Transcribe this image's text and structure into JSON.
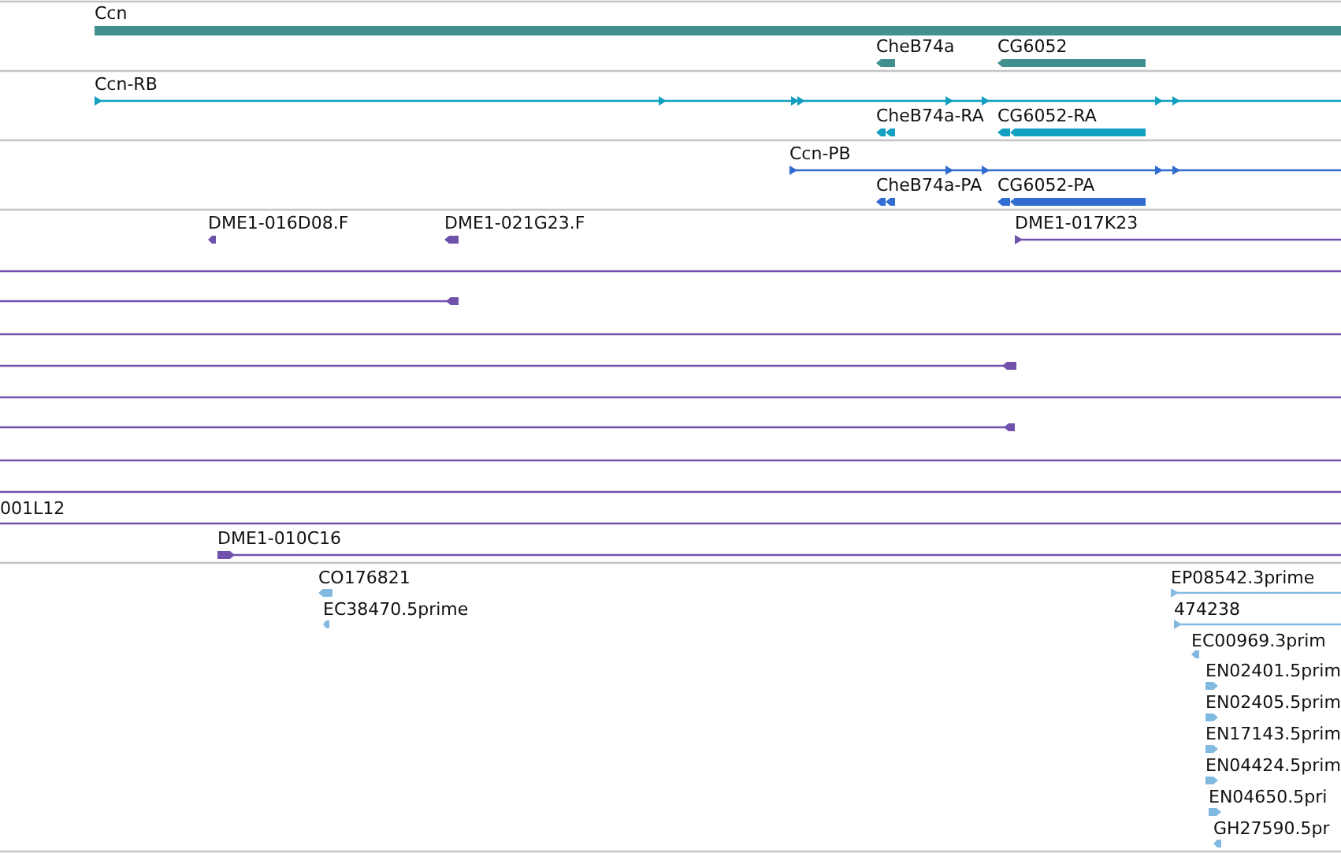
{
  "tracks": [
    {
      "color": "#418f8f",
      "features": [
        {
          "label": "Ccn",
          "kind": "block",
          "forward": true
        },
        {
          "label": "CheB74a",
          "kind": "block",
          "forward": false
        },
        {
          "label": "CG6052",
          "kind": "block",
          "forward": false
        }
      ]
    },
    {
      "color": "#12a0c0",
      "features": [
        {
          "label": "Ccn-RB",
          "kind": "line",
          "forward": true
        },
        {
          "label": "CheB74a-RA",
          "kind": "block",
          "forward": false
        },
        {
          "label": "CG6052-RA",
          "kind": "block",
          "forward": false
        }
      ]
    },
    {
      "color": "#316cd0",
      "features": [
        {
          "label": "Ccn-PB",
          "kind": "line",
          "forward": true
        },
        {
          "label": "CheB74a-PA",
          "kind": "block",
          "forward": false
        },
        {
          "label": "CG6052-PA",
          "kind": "block",
          "forward": false
        }
      ]
    },
    {
      "color": "#7052ad",
      "features": [
        {
          "label": "DME1-016D08.F",
          "kind": "block",
          "forward": false
        },
        {
          "label": "DME1-021G23.F",
          "kind": "block",
          "forward": false
        },
        {
          "label": "DME1-017K23",
          "kind": "line",
          "forward": true
        },
        {
          "kind": "line"
        },
        {
          "kind": "line",
          "forward": false
        },
        {
          "kind": "line"
        },
        {
          "kind": "line",
          "forward": false
        },
        {
          "kind": "line"
        },
        {
          "kind": "line",
          "forward": false
        },
        {
          "kind": "line"
        },
        {
          "kind": "line"
        },
        {
          "label": "001L12",
          "kind": "line"
        },
        {
          "label": "DME1-010C16",
          "kind": "line",
          "forward": true
        }
      ]
    },
    {
      "color": "#82b9e0",
      "features": [
        {
          "label": "CO176821",
          "kind": "block",
          "forward": false
        },
        {
          "label": "EC38470.5prime",
          "kind": "block",
          "forward": false
        },
        {
          "label": "EP08542.3prime",
          "kind": "line",
          "forward": true
        },
        {
          "label": "474238",
          "kind": "line",
          "forward": true
        },
        {
          "label": "EC00969.3prim",
          "kind": "block",
          "forward": false
        },
        {
          "label": "EN02401.5prim",
          "kind": "block",
          "forward": true
        },
        {
          "label": "EN02405.5prim",
          "kind": "block",
          "forward": true
        },
        {
          "label": "EN17143.5prim",
          "kind": "block",
          "forward": true
        },
        {
          "label": "EN04424.5prim",
          "kind": "block",
          "forward": true
        },
        {
          "label": "EN04650.5pri",
          "kind": "block",
          "forward": true
        },
        {
          "label": "GH27590.5pr",
          "kind": "block",
          "forward": false
        }
      ]
    }
  ]
}
